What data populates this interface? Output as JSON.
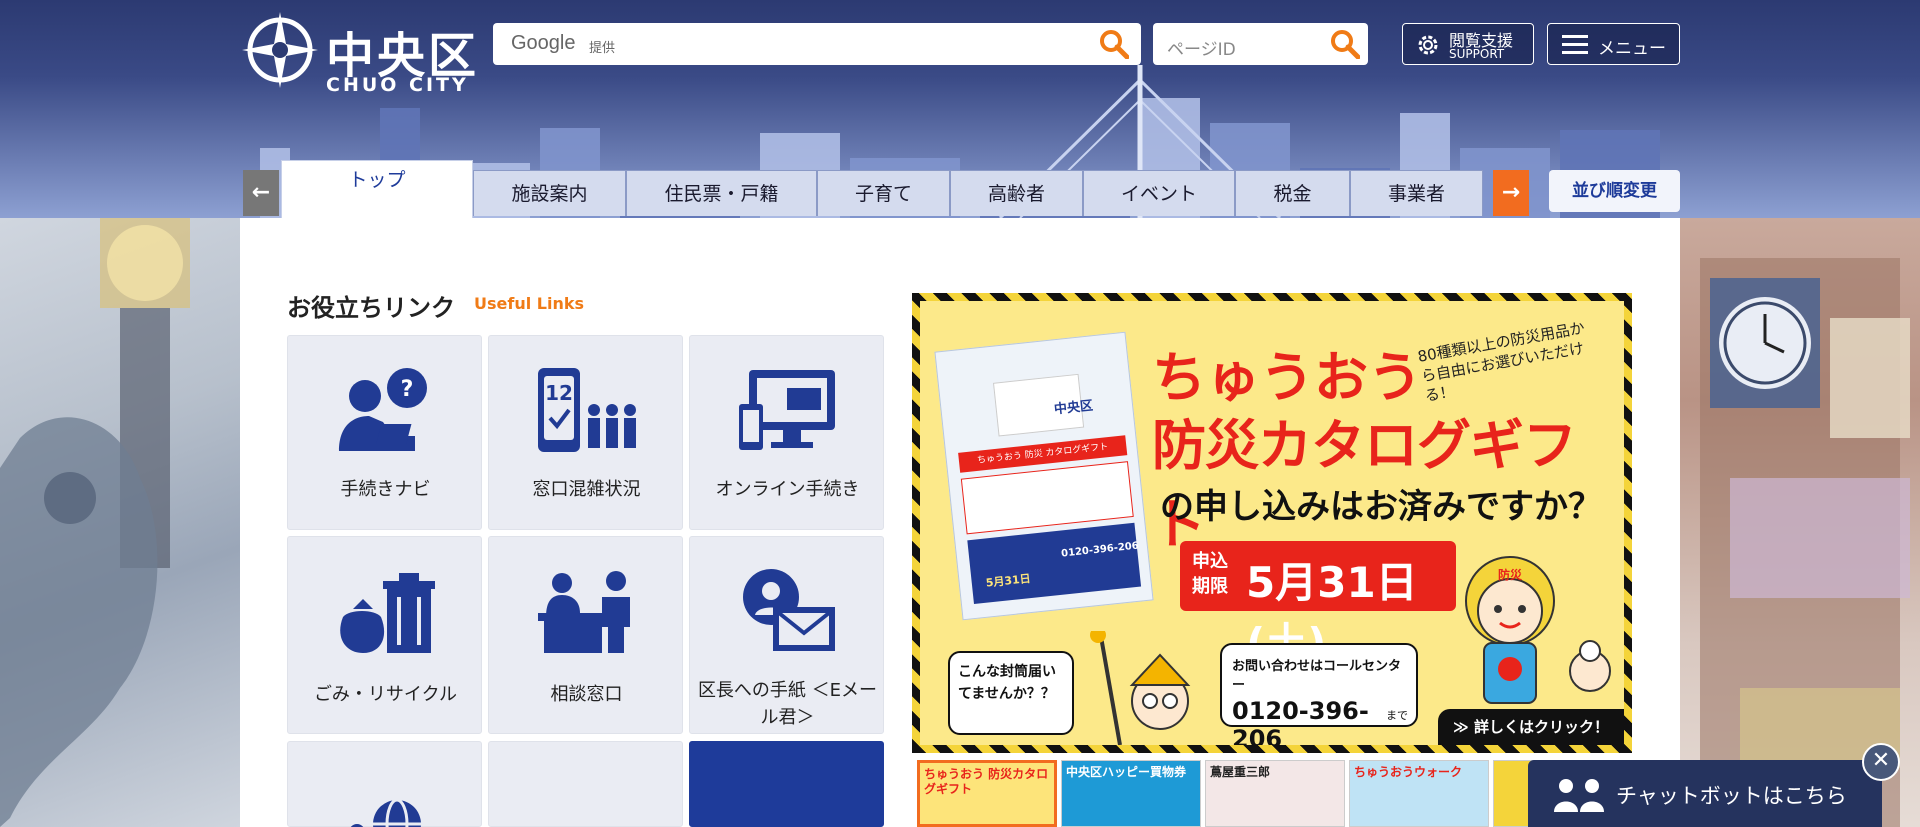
{
  "header": {
    "logo": {
      "name": "中央区",
      "sub": "CHUO CITY"
    },
    "search": {
      "provider": "Google",
      "provided_label": "提供",
      "placeholder": ""
    },
    "page_id": {
      "placeholder": "ページID"
    },
    "support_button": {
      "label": "閲覧支援",
      "sub": "SUPPORT"
    },
    "menu_button": {
      "label": "メニュー"
    }
  },
  "tabs": {
    "items": [
      {
        "label": "トップ",
        "active": true
      },
      {
        "label": "施設案内"
      },
      {
        "label": "住民票・戸籍"
      },
      {
        "label": "子育て"
      },
      {
        "label": "高齢者"
      },
      {
        "label": "イベント"
      },
      {
        "label": "税金"
      },
      {
        "label": "事業者"
      }
    ],
    "left_arrow": "←",
    "right_arrow": "→",
    "order_button": "並び順変更"
  },
  "useful_links": {
    "title": "お役立ちリンク",
    "subtitle": "Useful Links",
    "items": [
      {
        "label": "手続きナビ",
        "icon": "person-question-icon"
      },
      {
        "label": "窓口混雑状況",
        "icon": "queue-number-icon"
      },
      {
        "label": "オンライン手続き",
        "icon": "computer-phone-icon"
      },
      {
        "label": "ごみ・リサイクル",
        "icon": "trash-bag-icon"
      },
      {
        "label": "相談窓口",
        "icon": "consultation-counter-icon"
      },
      {
        "label": "区長への手紙 ＜Eメール君＞",
        "icon": "person-mail-icon"
      },
      {
        "label": "",
        "icon": "globe-person-icon"
      },
      {
        "label": "",
        "icon": "dome-icon"
      },
      {
        "label": "",
        "icon": ""
      }
    ]
  },
  "banner": {
    "line1": "ちゅうおう",
    "line2": "防災カタログギフト",
    "line3": "の申し込みはお済みですか？",
    "note": "80種類以上の防災用品から自由にお選びいただける！",
    "deadline_label": "申込期限",
    "deadline_date": "5月31日(土)",
    "bubble_left": "こんな封筒届いてませんか？？",
    "contact_label": "お問い合わせはコールセンター",
    "contact_number": "0120-396-206",
    "contact_suffix": "まで",
    "more": "≫ 詳しくはクリック！",
    "card_logo": "中央区",
    "card_title": "ちゅうおう 防災 カタログギフト",
    "card_phone": "0120-396-206",
    "card_date": "5月31日",
    "char_label": "防災"
  },
  "thumbnails": [
    {
      "text": "ちゅうおう 防災カタログギフト",
      "bg": "#fde47a",
      "fg": "#e8241b"
    },
    {
      "text": "中央区ハッピー買物券",
      "bg": "#1e9ad6",
      "fg": "#ffffff"
    },
    {
      "text": "蔦屋重三郎",
      "bg": "#f3e7e7",
      "fg": "#222222"
    },
    {
      "text": "ちゅうおうウォーク",
      "bg": "#bfe3f5",
      "fg": "#e8241b"
    },
    {
      "text": "",
      "bg": "#f4d43a",
      "fg": "#111111"
    }
  ],
  "chatbot": {
    "label": "チャットボットはこちら",
    "close": "✕"
  },
  "colors": {
    "header_dark": "#2c3a72",
    "accent_orange": "#f07b16",
    "arrow_orange": "#f26c1f",
    "navy": "#1e3b9a",
    "banner_red": "#e8241b"
  }
}
